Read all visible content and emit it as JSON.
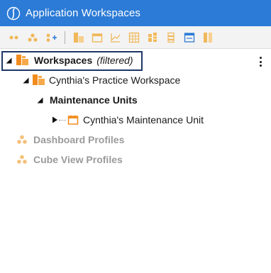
{
  "window": {
    "title": "Application Workspaces"
  },
  "toolbar": {
    "buttons": [
      "collapse-all-icon",
      "people-group-icon",
      "add-people-icon",
      "workspace-icon",
      "calendar-icon",
      "chart-icon",
      "grid-icon",
      "stacked-blocks-icon",
      "layers-icon",
      "form-icon",
      "panel-icon"
    ]
  },
  "tree": {
    "root": {
      "label": "Workspaces",
      "suffix": "(filtered)"
    },
    "workspace": {
      "label": "Cynthia's Practice Workspace"
    },
    "group": {
      "label": "Maintenance Units"
    },
    "unit": {
      "label": "Cynthia's Maintenance Unit"
    },
    "dashboard_profiles": {
      "label": "Dashboard Profiles"
    },
    "cube_view_profiles": {
      "label": "Cube View Profiles"
    }
  },
  "colors": {
    "titlebar": "#2c7bd6",
    "selection_border": "#1f3768",
    "orange": "#f28c1e",
    "muted": "#9a9a9a"
  }
}
